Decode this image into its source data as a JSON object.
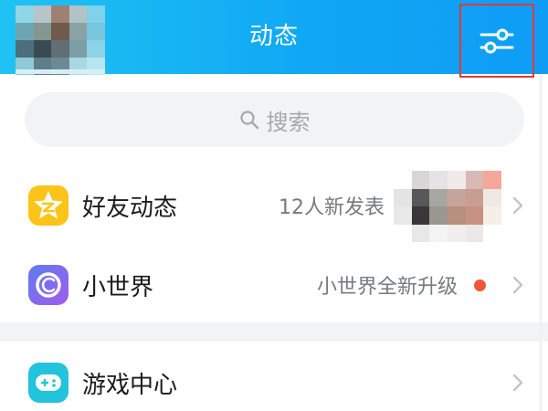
{
  "header": {
    "title": "动态",
    "settings_icon": "sliders-icon",
    "highlight_color": "#e03a3a",
    "gradient_start": "#1fc3f2",
    "gradient_end": "#0f9cf5"
  },
  "search": {
    "placeholder": "搜索",
    "icon": "search-icon"
  },
  "items": [
    {
      "label": "好友动态",
      "sublabel": "12人新发表",
      "icon": "qzone-star-icon",
      "icon_color": "#fcc419",
      "has_thumbnail": true
    },
    {
      "label": "小世界",
      "sublabel": "小世界全新升级",
      "icon": "small-world-icon",
      "icon_color": "#7c5cf0",
      "badge_color": "#f0553a"
    },
    {
      "label": "游戏中心",
      "sublabel": "",
      "icon": "gamepad-icon",
      "icon_color": "#22c4dc"
    }
  ]
}
